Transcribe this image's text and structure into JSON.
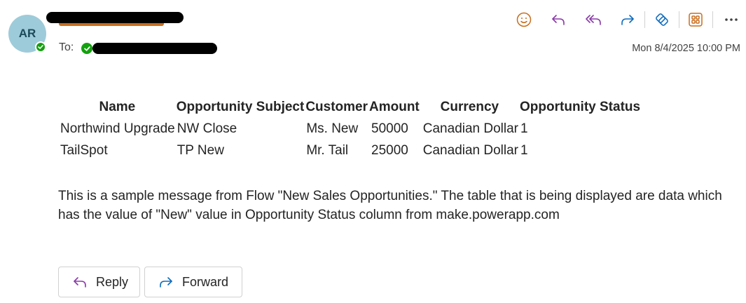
{
  "sender": {
    "initials": "AR"
  },
  "recipient": {
    "to_label": "To:"
  },
  "datetime": "Mon 8/4/2025 10:00 PM",
  "toolbar": {
    "items": [
      "emoji-icon",
      "reply-icon",
      "reply-all-icon",
      "forward-icon",
      "loop-icon",
      "apps-icon",
      "more-icon"
    ]
  },
  "table": {
    "headers": [
      "Name",
      "Opportunity Subject",
      "Customer",
      "Amount",
      "Currency",
      "Opportunity Status"
    ],
    "rows": [
      [
        "Northwind Upgrade",
        "NW Close",
        "Ms. New",
        "50000",
        "Canadian Dollar",
        "1"
      ],
      [
        "TailSpot",
        "TP New",
        "Mr. Tail",
        "25000",
        "Canadian Dollar",
        "1"
      ]
    ]
  },
  "message": "This is a sample message from Flow \"New Sales Opportunities.\" The table that is being displayed are data which has the value of \"New\" value in Opportunity Status column from make.powerapp.com",
  "actions": {
    "reply_label": "Reply",
    "forward_label": "Forward"
  },
  "colors": {
    "accent_purple": "#8a3aa8",
    "accent_blue": "#0f6cbd",
    "accent_orange": "#c86d1d",
    "presence_green": "#13a10e"
  }
}
